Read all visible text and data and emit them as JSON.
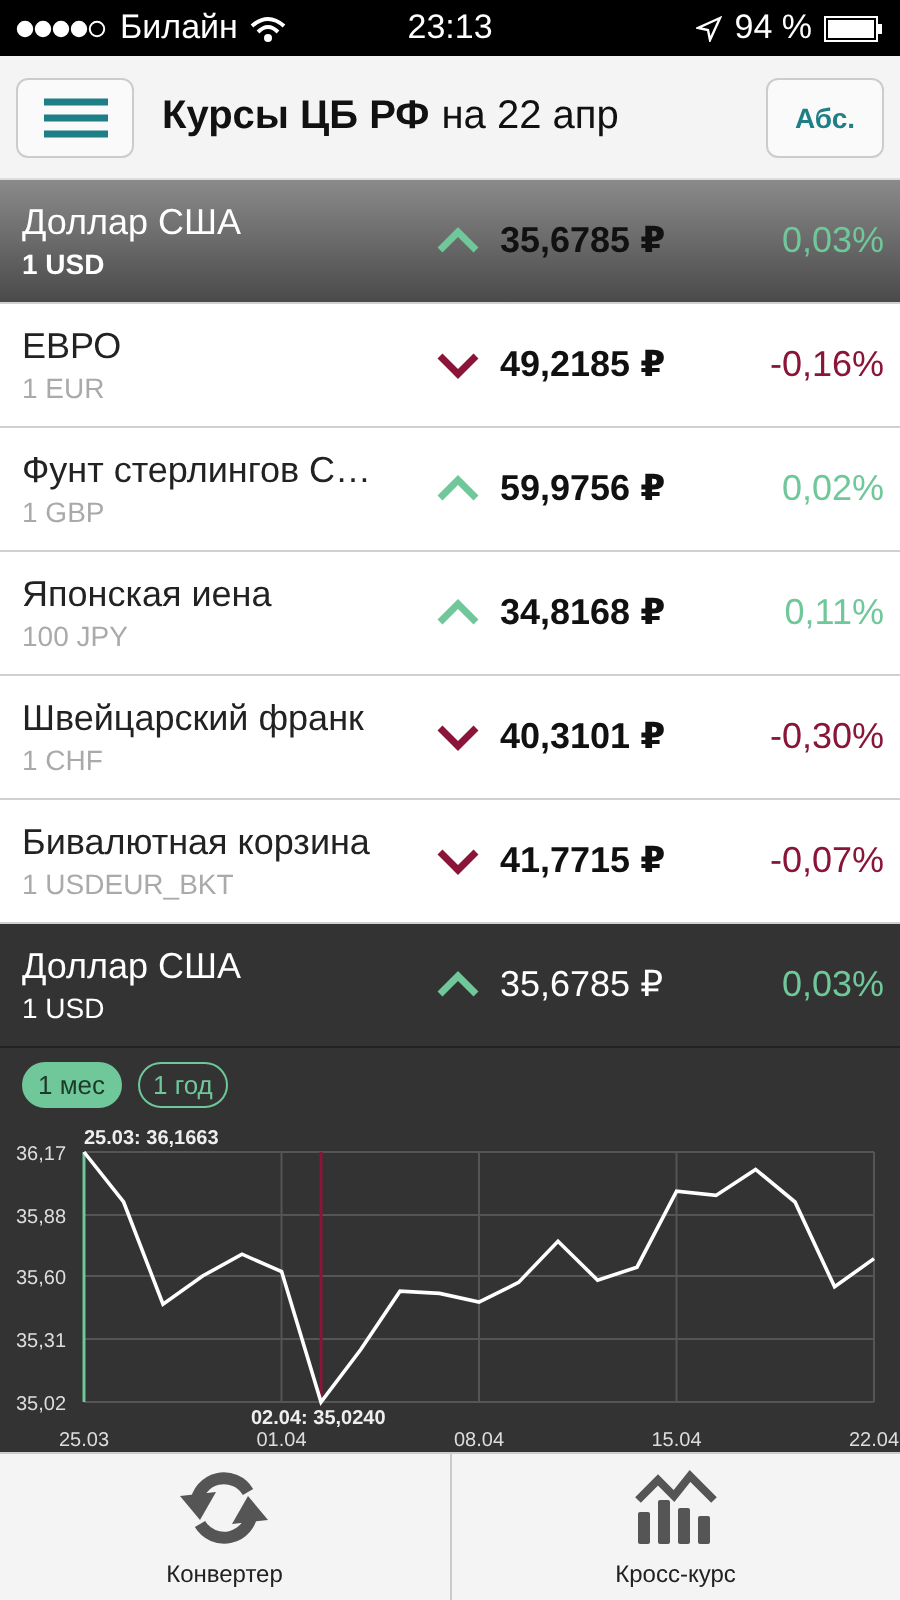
{
  "status_bar": {
    "carrier": "Билайн",
    "time": "23:13",
    "battery": "94 %"
  },
  "header": {
    "title": "Курсы ЦБ РФ",
    "subtitle": "на 22 апр",
    "button": "Абс."
  },
  "rates": [
    {
      "name": "Доллар США",
      "unit": "1 USD",
      "rate": "35,6785 ₽",
      "change": "0,03%",
      "kind": "up",
      "selected": true
    },
    {
      "name": "ЕВРО",
      "unit": "1 EUR",
      "rate": "49,2185 ₽",
      "change": "-0,16%",
      "kind": "down",
      "selected": false
    },
    {
      "name": "Фунт стерлингов С…",
      "unit": "1 GBP",
      "rate": "59,9756 ₽",
      "change": "0,02%",
      "kind": "up",
      "selected": false
    },
    {
      "name": "Японская иена",
      "unit": "100 JPY",
      "rate": "34,8168 ₽",
      "change": "0,11%",
      "kind": "up",
      "selected": false
    },
    {
      "name": "Швейцарский франк",
      "unit": "1 CHF",
      "rate": "40,3101 ₽",
      "change": "-0,30%",
      "kind": "down",
      "selected": false
    },
    {
      "name": "Бивалютная корзина",
      "unit": "1 USDEUR_BKT",
      "rate": "41,7715 ₽",
      "change": "-0,07%",
      "kind": "down",
      "selected": false
    }
  ],
  "detail": {
    "name": "Доллар США",
    "unit": "1 USD",
    "rate": "35,6785 ₽",
    "change": "0,03%",
    "kind": "up",
    "periods": [
      {
        "label": "1 мес",
        "selected": true
      },
      {
        "label": "1 год",
        "selected": false
      }
    ],
    "chart_data": {
      "type": "line",
      "categories": [
        "25.03",
        null,
        null,
        null,
        null,
        "01.04",
        null,
        null,
        null,
        null,
        "08.04",
        null,
        null,
        null,
        null,
        "15.04",
        null,
        null,
        null,
        null,
        "22.04"
      ],
      "series": [
        {
          "color": "#ffffff",
          "values": [
            36.17,
            35.94,
            35.47,
            35.6,
            35.7,
            35.62,
            35.02,
            35.26,
            35.53,
            35.52,
            35.48,
            35.57,
            35.76,
            35.58,
            35.64,
            35.99,
            35.97,
            36.09,
            35.94,
            35.55,
            35.68
          ]
        }
      ],
      "ylim": [
        35.02,
        36.17
      ],
      "yticks": [
        {
          "value": 36.17,
          "label": "36,17"
        },
        {
          "value": 35.88,
          "label": "35,88"
        },
        {
          "value": 35.6,
          "label": "35,60"
        },
        {
          "value": 35.31,
          "label": "35,31"
        },
        {
          "value": 35.02,
          "label": "35,02"
        }
      ],
      "grid": true,
      "annotations": [
        "25.03: 36,1663",
        "02.04: 35,0240"
      ]
    }
  },
  "tabs": [
    {
      "label": "Конвертер",
      "kind": "converter"
    },
    {
      "label": "Кросс-курс",
      "kind": "cross"
    }
  ]
}
